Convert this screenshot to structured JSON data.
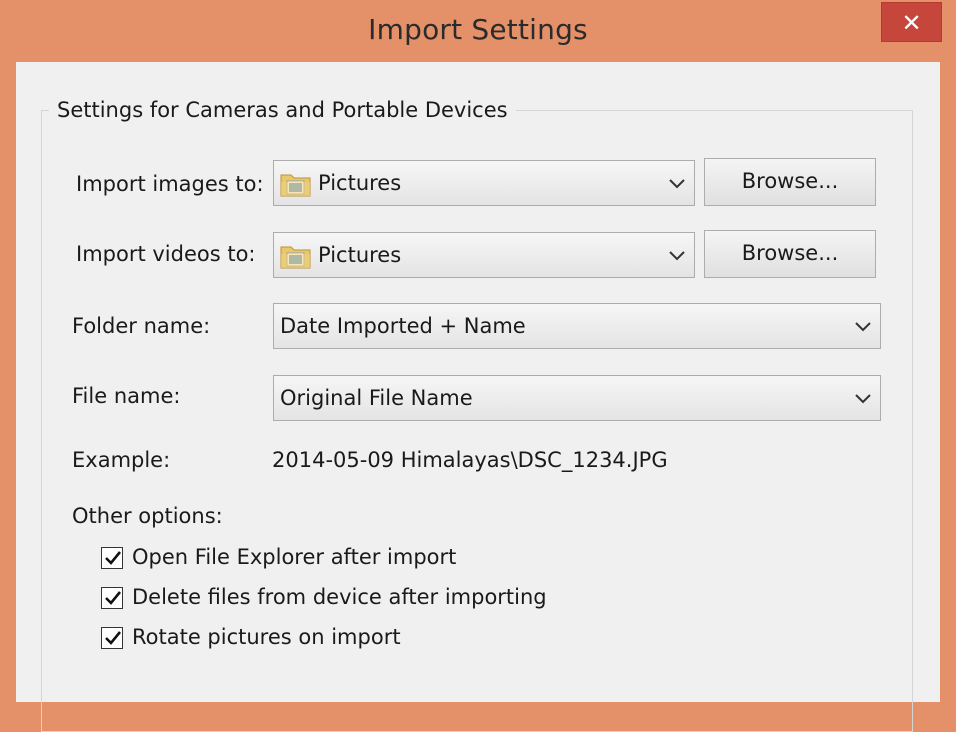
{
  "window": {
    "title": "Import Settings",
    "close_glyph": "✕"
  },
  "group": {
    "title": "Settings for Cameras and Portable Devices"
  },
  "import_images": {
    "label": "Import images to:",
    "value": "Pictures",
    "browse": "Browse..."
  },
  "import_videos": {
    "label": "Import videos to:",
    "value": "Pictures",
    "browse": "Browse..."
  },
  "folder_name": {
    "label": "Folder name:",
    "value": "Date Imported + Name"
  },
  "file_name": {
    "label": "File name:",
    "value": "Original File Name"
  },
  "example": {
    "label": "Example:",
    "value": "2014-05-09 Himalayas\\DSC_1234.JPG"
  },
  "other_options": {
    "label": "Other options:",
    "items": [
      {
        "label": "Open File Explorer after import",
        "checked": true
      },
      {
        "label": "Delete files from device after importing",
        "checked": true
      },
      {
        "label": "Rotate pictures on import",
        "checked": true
      }
    ]
  },
  "icons": {
    "folder": "folder-icon",
    "dropdown": "chevron-down-icon",
    "check": "checkmark-icon",
    "close": "close-icon"
  },
  "colors": {
    "titlebar": "#e4916a",
    "close_button": "#c7463c",
    "client": "#f0f0f0"
  }
}
